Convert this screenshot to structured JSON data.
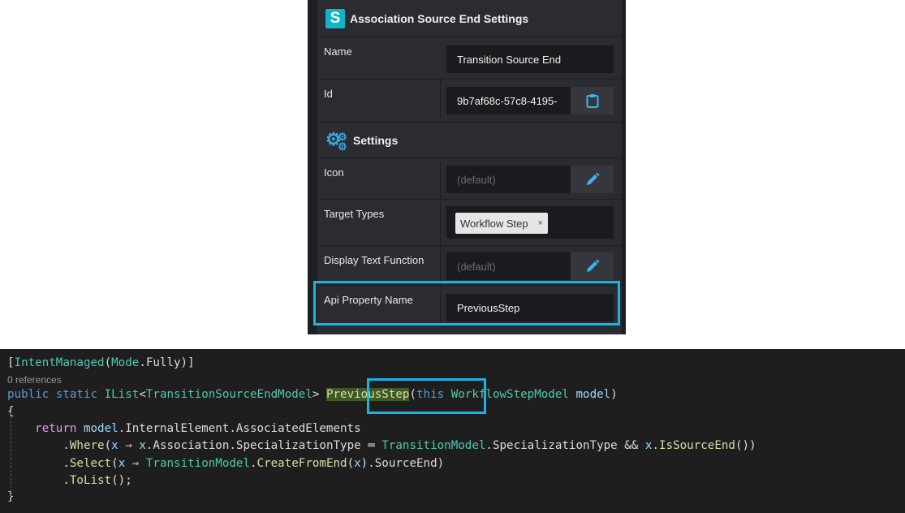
{
  "panel": {
    "header_title": "Association Source End Settings",
    "header_icon": "S",
    "rows": {
      "name": {
        "label": "Name",
        "value": "Transition Source End"
      },
      "id": {
        "label": "Id",
        "value": "9b7af68c-57c8-4195-"
      },
      "settings_header": "Settings",
      "icon": {
        "label": "Icon",
        "placeholder": "(default)"
      },
      "target_types": {
        "label": "Target Types",
        "chip": "Workflow Step",
        "chip_remove": "×"
      },
      "display_text_function": {
        "label": "Display Text Function",
        "placeholder": "(default)"
      },
      "api_property_name": {
        "label": "Api Property Name",
        "value": "PreviousStep"
      }
    },
    "colors": {
      "accent": "#18b4e8",
      "panel_bg": "#2b2c31",
      "field_bg": "#1a1b1e",
      "logo": "#0fb5c9"
    }
  },
  "code": {
    "line1": {
      "open": "[",
      "attr": "IntentManaged",
      "p1": "(",
      "mode": "Mode",
      "rest": ".Fully)]"
    },
    "references": "0 references",
    "line3": {
      "public": "public",
      "static": "static",
      "ilist": "IList",
      "lt": "<",
      "model": "TransitionSourceEndModel",
      "gt": ">",
      "method": "PreviousStep",
      "p_open": "(",
      "this": "this",
      "ptype": "WorkflowStepModel",
      "pname": "model",
      "p_close": ")"
    },
    "brace_open": "{",
    "line5": {
      "ret": "return",
      "obj": "model",
      "rest": ".InternalElement.AssociatedElements"
    },
    "line6": {
      "dot": ".",
      "where": "Where",
      "p": "(",
      "x1": "x",
      "arrow": " ⇒ ",
      "x2": "x",
      "mid": ".Association.SpecializationType ═ ",
      "tm": "TransitionModel",
      "mid2": ".SpecializationType && ",
      "x3": "x",
      "end1": ".",
      "isend": "IsSourceEnd",
      "end2": "())"
    },
    "line7": {
      "dot": ".",
      "select": "Select",
      "p": "(",
      "x1": "x",
      "arrow": " ⇒ ",
      "tm": "TransitionModel",
      "d": ".",
      "cfe": "CreateFromEnd",
      "p2": "(",
      "x2": "x",
      "end": ").SourceEnd)"
    },
    "line8": {
      "dot": ".",
      "tolist": "ToList",
      "end": "();"
    },
    "brace_close": "}"
  }
}
